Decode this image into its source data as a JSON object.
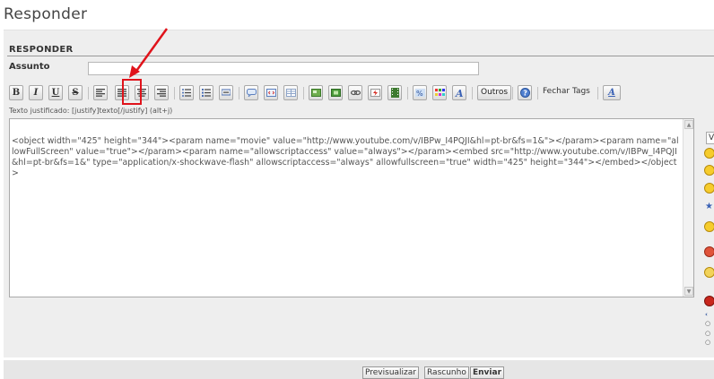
{
  "page": {
    "title": "Responder"
  },
  "form": {
    "section_title": "RESPONDER",
    "subject_label": "Assunto",
    "subject_value": "",
    "helpline": "Texto justificado: [justify]texto[/justify] (alt+j)",
    "message": "<object width=\"425\" height=\"344\"><param name=\"movie\" value=\"http://www.youtube.com/v/IBPw_I4PQJI&hl=pt-br&fs=1&\"></param><param name=\"allowFullScreen\" value=\"true\"></param><param name=\"allowscriptaccess\" value=\"always\"></param><embed src=\"http://www.youtube.com/v/IBPw_I4PQJI&hl=pt-br&fs=1&\" type=\"application/x-shockwave-flash\" allowscriptaccess=\"always\" allowfullscreen=\"true\" width=\"425\" height=\"344\"></embed></object>"
  },
  "toolbar": {
    "bold": "B",
    "italic": "I",
    "underline": "U",
    "strike": "S",
    "outros": "Outros",
    "close_tags": "Fechar Tags",
    "font_size_glyph": "A"
  },
  "side": {
    "select_value": "V"
  },
  "buttons": {
    "preview": "Previsualizar",
    "draft": "Rascunho",
    "send": "Enviar"
  },
  "colors": {
    "highlight": "#e0131b",
    "panel": "#eeeeee"
  }
}
